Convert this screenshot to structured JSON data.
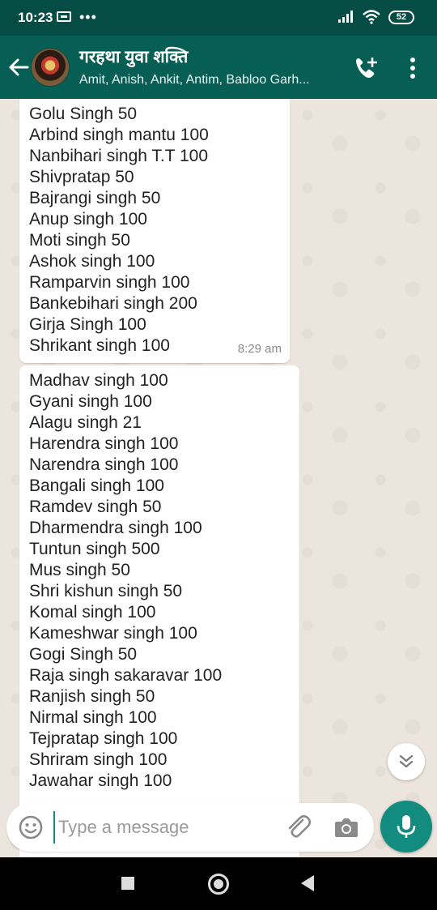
{
  "status_bar": {
    "time": "10:23",
    "battery": "52"
  },
  "header": {
    "title": "गरहथा युवा शक्ति",
    "subtitle": "Amit, Anish, Ankit, Antim, Babloo Garh..."
  },
  "messages": [
    {
      "lines": [
        "Golu Singh 50",
        "Arbind singh mantu 100",
        "Nanbihari singh T.T 100",
        "Shivpratap 50",
        "Bajrangi singh 50",
        "Anup singh 100",
        "Moti singh 50",
        "Ashok singh 100",
        "Ramparvin singh 100",
        "Bankebihari singh 200",
        "Girja Singh 100",
        "Shrikant singh 100"
      ],
      "time": "8:29 am"
    },
    {
      "lines": [
        "Madhav singh 100",
        "Gyani singh 100",
        "Alagu singh 21",
        "Harendra singh 100",
        "Narendra singh 100",
        "Bangali singh 100",
        "Ramdev singh 50",
        "Dharmendra singh 100",
        "Tuntun singh 500",
        "Mus singh 50",
        "Shri kishun singh 50",
        "Komal singh 100",
        "Kameshwar singh 100",
        "Gogi Singh 50",
        "Raja singh sakaravar 100",
        "Ranjish singh 50",
        "Nirmal singh 100",
        "Tejpratap singh 100",
        "Shriram singh 100",
        "Jawahar singh 100"
      ]
    }
  ],
  "composer": {
    "placeholder": "Type a message"
  },
  "colors": {
    "header": "#075e54",
    "status_bar": "#054d44",
    "accent": "#128c7e",
    "chat_bg": "#ece5dd"
  },
  "icons": {
    "back": "arrow-left-icon",
    "call": "call-add-icon",
    "menu": "more-vert-icon",
    "emoji": "emoji-icon",
    "attach": "paperclip-icon",
    "camera": "camera-icon",
    "mic": "mic-icon",
    "scroll": "chevron-double-down-icon"
  }
}
